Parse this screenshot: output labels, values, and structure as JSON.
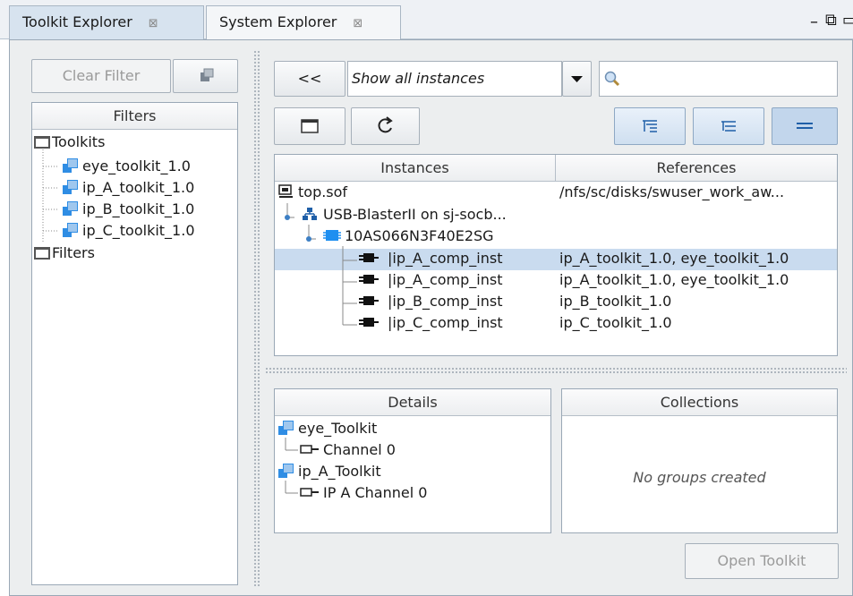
{
  "tabs": [
    {
      "label": "Toolkit Explorer",
      "close": "⊠"
    },
    {
      "label": "System Explorer",
      "close": "⊠"
    }
  ],
  "window_controls": {
    "minimize": "–",
    "restore": "⧉",
    "maximize": "▭"
  },
  "left_panel": {
    "clear_filter_label": "Clear Filter",
    "filters_header": "Filters",
    "tree": {
      "toolkits_label": "Toolkits",
      "items": [
        "eye_toolkit_1.0",
        "ip_A_toolkit_1.0",
        "ip_B_toolkit_1.0",
        "ip_C_toolkit_1.0"
      ],
      "filters_label": "Filters"
    }
  },
  "toolbar": {
    "back_label": "<<",
    "dropdown_value": "Show all instances",
    "search_placeholder": ""
  },
  "instances_table": {
    "headers": [
      "Instances",
      "References"
    ],
    "rows": [
      {
        "instance": "top.sof",
        "reference": "/nfs/sc/disks/swuser_work_aw..."
      },
      {
        "instance": "USB-BlasterII on sj-socb...",
        "reference": ""
      },
      {
        "instance": "10AS066N3F40E2SG",
        "reference": ""
      },
      {
        "instance": "|ip_A_comp_inst",
        "reference": "ip_A_toolkit_1.0, eye_toolkit_1.0"
      },
      {
        "instance": "|ip_A_comp_inst",
        "reference": "ip_A_toolkit_1.0, eye_toolkit_1.0"
      },
      {
        "instance": "|ip_B_comp_inst",
        "reference": "ip_B_toolkit_1.0"
      },
      {
        "instance": "|ip_C_comp_inst",
        "reference": "ip_C_toolkit_1.0"
      }
    ]
  },
  "details": {
    "header": "Details",
    "items": [
      {
        "toolkit": "eye_Toolkit",
        "channel": "Channel 0"
      },
      {
        "toolkit": "ip_A_Toolkit",
        "channel": "IP A Channel 0"
      }
    ]
  },
  "collections": {
    "header": "Collections",
    "empty_text": "No groups created"
  },
  "open_toolkit_label": "Open Toolkit"
}
